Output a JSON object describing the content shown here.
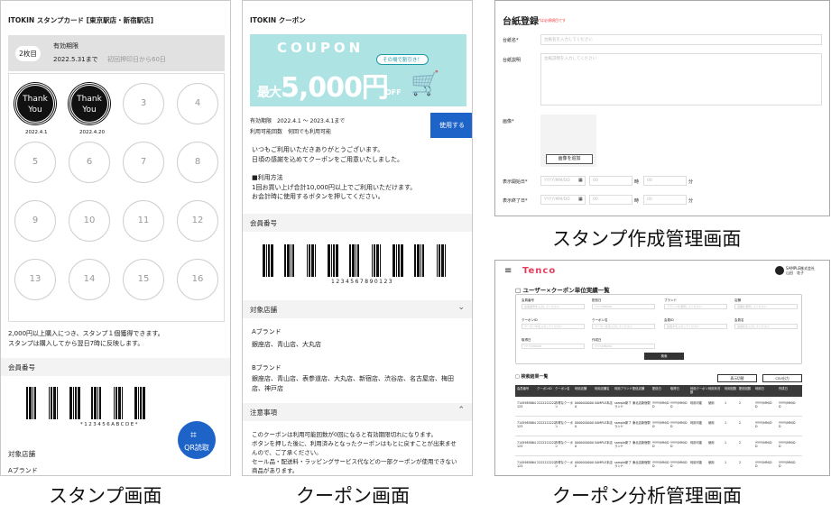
{
  "stamp": {
    "title": "ITOKIN スタンプカード [東京駅店・新宿駅店]",
    "badge": "2枚目",
    "validity_label": "有効期限",
    "validity_date": "2022.5.31まで",
    "validity_note": "初回押印日から60日",
    "stamps": [
      {
        "label": "Thank You",
        "date": "2022.4.1",
        "stamped": true
      },
      {
        "label": "Thank You",
        "date": "2022.4.20",
        "stamped": true
      },
      {
        "label": "3"
      },
      {
        "label": "4"
      },
      {
        "label": "5"
      },
      {
        "label": "6"
      },
      {
        "label": "7"
      },
      {
        "label": "8"
      },
      {
        "label": "9"
      },
      {
        "label": "10"
      },
      {
        "label": "11"
      },
      {
        "label": "12"
      },
      {
        "label": "13"
      },
      {
        "label": "14"
      },
      {
        "label": "15"
      },
      {
        "label": "16"
      }
    ],
    "note1": "2,000円以上購入につき、スタンプ１個獲得できます。",
    "note2": "スタンプは購入してから翌日7時に反映します。",
    "member_label": "会員番号",
    "barcode_text": "*123456ABCDE*",
    "store_label": "対象店舗",
    "brand_partial": "Aブランド",
    "qr_label": "QR読取",
    "qr_icon": "qr-scan-icon"
  },
  "coupon": {
    "title": "ITOKIN クーポン",
    "banner_word": "COUPON",
    "banner_bubble": "その場で割引き！",
    "banner_prefix": "最大",
    "banner_amount": "5,000円",
    "banner_suffix": "OFF",
    "validity_label": "有効期限",
    "validity_value": "2022.4.1 ～ 2023.4.1まで",
    "count_label": "利用可能回数",
    "count_value": "何回でも利用可能",
    "use_button": "使用する",
    "msg1": "いつもご利用いただきありがとうございます。",
    "msg2": "日頃の感謝を込めてクーポンをご用意いたしました。",
    "method_title": "■利用方法",
    "method1": "1回お買い上げ合計10,000円以上でご利用いただけます。",
    "method2": "お会計時に使用するボタンを押してください。",
    "member_label": "会員番号",
    "barcode_text": "1234567890123",
    "store_label": "対象店舗",
    "brand_a": "Aブランド",
    "brand_a_stores": "銀座店、青山店、大丸店",
    "brand_b": "Bブランド",
    "brand_b_stores1": "銀座店、青山店、表参道店、大丸店、新宿店、渋谷店、名古屋店、梅田",
    "brand_b_stores2": "店、神戸店",
    "notice_label": "注意事項",
    "notice1": "このクーポンは利用可能回数が0回になると有効期限切れになります。",
    "notice2": "ボタンを押した後に、利用済みとなったクーポンはもとに戻すことが出来ませ",
    "notice3": "んので、ご了承ください。",
    "notice4": "セール品・配送料・ラッピングサービス代などの一部クーポンが使用できない",
    "notice5": "商品があります。"
  },
  "admin_form": {
    "title": "台紙登録",
    "required_note": "*は必須項目です",
    "name_label": "台紙名*",
    "name_placeholder": "台紙名を入力してください",
    "desc_label": "台紙説明",
    "desc_placeholder": "台紙説明を入力してください",
    "image_label": "画像*",
    "image_button": "画像を追加",
    "start_label": "表示開始日*",
    "end_label": "表示終了日*",
    "date_placeholder": "YYYY/MM/DD",
    "hour_placeholder": "00",
    "hour_unit": "時",
    "minute_unit": "分"
  },
  "analysis": {
    "logo": "Tenco",
    "user_company": "SAMPLE株式会社",
    "user_name": "山田　花子",
    "title": "□ ユーザー×クーポン単位実績一覧",
    "filters": [
      {
        "label": "会員番号",
        "placeholder": "会員番号を入力してください"
      },
      {
        "label": "配信日",
        "placeholder": "YYYY/MM/DD"
      },
      {
        "label": "ブランド",
        "placeholder": "ブランドを選択してください"
      },
      {
        "label": "店舗",
        "placeholder": "店舗を選択してください"
      },
      {
        "label": "クーポンID",
        "placeholder": "クーポンIDを入力してください"
      },
      {
        "label": "クーポン名",
        "placeholder": "クーポン名を入力してください"
      },
      {
        "label": "会員ID",
        "placeholder": "会員IDを入力してください"
      },
      {
        "label": "会員名",
        "placeholder": "会員名を入力してください"
      },
      {
        "label": "取得日",
        "placeholder": "YYYY/MM/DD"
      },
      {
        "label": "作成日",
        "placeholder": "YYYY/MM/DD"
      }
    ],
    "search_button": "検索",
    "results_label": "□ 検索結果一覧",
    "btn_csv": "表示切替",
    "btn_csv2": "CSV出力",
    "columns": [
      "会員番号",
      "クーポンID",
      "クーポン名",
      "利用店舗",
      "利用店舗名",
      "利用ブランド",
      "配信店舗",
      "配信日",
      "取得日",
      "利用クーポン数",
      "利用状況",
      "利用回数",
      "配信回数",
      "利用日",
      "作成日"
    ],
    "rows": [
      [
        "7145985864123",
        "2222222222",
        "お得なクーポン",
        "00000000000",
        "SAMPLE本店",
        "sample新ブランド",
        "東北店新宿駅",
        "YYYY/MM/DD",
        "YYYY/MM/DD",
        "利用可能",
        "使用",
        "1",
        "2",
        "YYYY/MM/DD",
        "YYYY/MM/DD"
      ],
      [
        "7145985864123",
        "2222222222",
        "お得なクーポン",
        "00000000000",
        "SAMPLE本店",
        "sample新ブランド",
        "東北店新宿駅",
        "YYYY/MM/DD",
        "YYYY/MM/DD",
        "利用可能",
        "使用",
        "1",
        "2",
        "YYYY/MM/DD",
        "YYYY/MM/DD"
      ],
      [
        "7145985864123",
        "2222222222",
        "お得なクーポン",
        "00000000000",
        "SAMPLE本店",
        "sample新ブランド",
        "東北店新宿駅",
        "YYYY/MM/DD",
        "YYYY/MM/DD",
        "利用可能",
        "使用",
        "1",
        "2",
        "YYYY/MM/DD",
        "YYYY/MM/DD"
      ],
      [
        "7145985864123",
        "2222222222",
        "お得なクーポン",
        "00000000000",
        "SAMPLE本店",
        "sample新ブランド",
        "東北店新宿駅",
        "YYYY/MM/DD",
        "YYYY/MM/DD",
        "利用可能",
        "使用",
        "1",
        "2",
        "YYYY/MM/DD",
        "YYYY/MM/DD"
      ]
    ]
  },
  "captions": {
    "stamp": "スタンプ画面",
    "coupon": "クーポン画面",
    "admin_form": "スタンプ作成管理画面",
    "analysis": "クーポン分析管理画面"
  }
}
